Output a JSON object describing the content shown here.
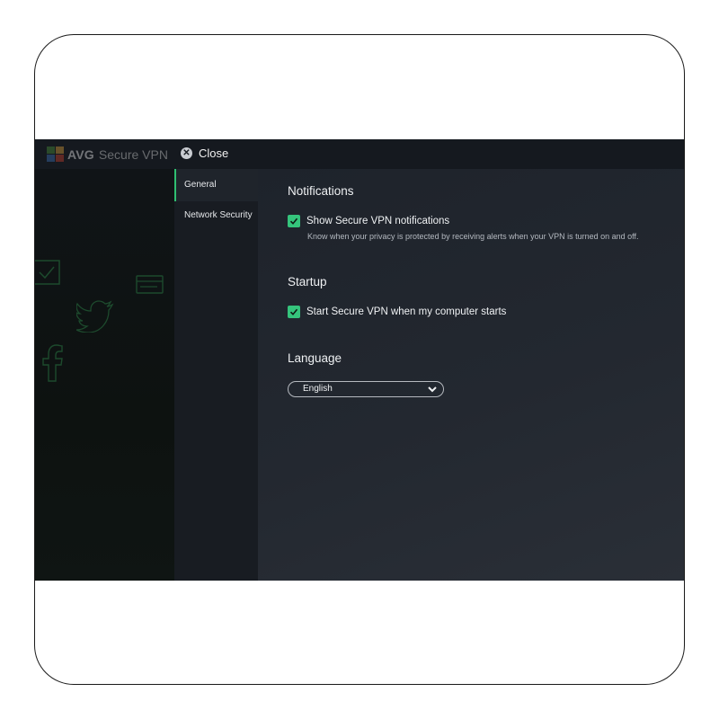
{
  "header": {
    "brand_name": "AVG",
    "product_name": "Secure VPN",
    "close_label": "Close"
  },
  "sidebar": {
    "items": [
      {
        "label": "General",
        "active": true
      },
      {
        "label": "Network Security",
        "active": false
      }
    ]
  },
  "settings": {
    "notifications": {
      "title": "Notifications",
      "checkbox_label": "Show Secure VPN notifications",
      "checked": true,
      "description": "Know when your privacy is protected by receiving alerts when your VPN is turned on and off."
    },
    "startup": {
      "title": "Startup",
      "checkbox_label": "Start Secure VPN when my computer starts",
      "checked": true
    },
    "language": {
      "title": "Language",
      "selected": "English"
    }
  },
  "icons": {
    "close": "close-icon",
    "checkbox": "checkmark-icon",
    "dropdown": "chevron-down-icon",
    "decorative": [
      "envelope-icon",
      "twitter-icon",
      "credit-card-icon",
      "facebook-icon"
    ]
  },
  "colors": {
    "accent": "#35c47c",
    "background": "#1c2129",
    "titlebar": "#15191f"
  }
}
